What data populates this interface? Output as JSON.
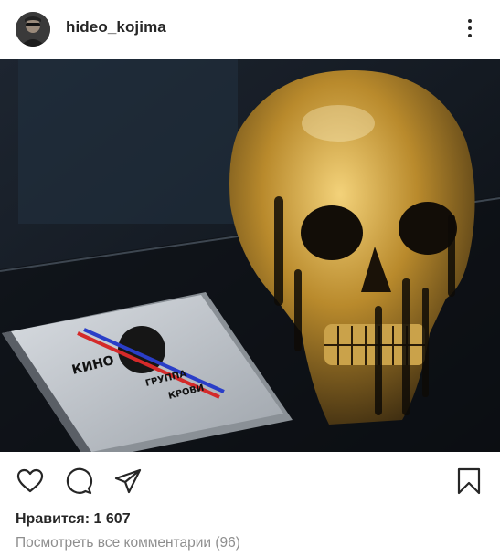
{
  "post": {
    "username": "hideo_kojima",
    "likes_label": "Нравится:",
    "likes_count": "1 607",
    "view_comments": "Посмотреть все комментарии (96)"
  },
  "icons": {
    "avatar": "avatar",
    "more": "more-vertical-icon",
    "like": "heart-icon",
    "comment": "comment-icon",
    "share": "send-icon",
    "save": "bookmark-icon"
  },
  "colors": {
    "text": "#262626",
    "muted": "#8e8e8e",
    "background": "#ffffff"
  }
}
